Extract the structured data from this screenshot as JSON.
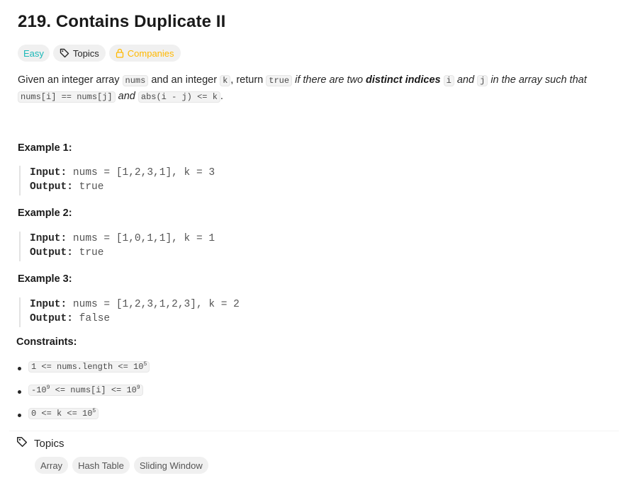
{
  "problem": {
    "title": "219. Contains Duplicate II",
    "difficulty": "Easy",
    "topics_label": "Topics",
    "companies_label": "Companies"
  },
  "description": {
    "t1": "Given an integer array ",
    "c1": "nums",
    "t2": " and an integer ",
    "c2": "k",
    "t3": ", return ",
    "c3": "true",
    "t4": " if there are two ",
    "b1": "distinct indices",
    "t5": " ",
    "c4": "i",
    "t6": " and ",
    "c5": "j",
    "t7": " in the array such that ",
    "c6": "nums[i] == nums[j]",
    "t8": " and ",
    "c7": "abs(i - j) <= k",
    "t9": "."
  },
  "examples": [
    {
      "title": "Example 1:",
      "input_label": "Input:",
      "input": "nums = [1,2,3,1], k = 3",
      "output_label": "Output:",
      "output": "true"
    },
    {
      "title": "Example 2:",
      "input_label": "Input:",
      "input": "nums = [1,0,1,1], k = 1",
      "output_label": "Output:",
      "output": "true"
    },
    {
      "title": "Example 3:",
      "input_label": "Input:",
      "input": "nums = [1,2,3,1,2,3], k = 2",
      "output_label": "Output:",
      "output": "false"
    }
  ],
  "constraints": {
    "title": "Constraints:",
    "items": [
      {
        "pre": "1 <= nums.length <= 10",
        "exp": "5",
        "post": ""
      },
      {
        "pre": "-10",
        "exp": "9",
        "mid": " <= nums[i] <= 10",
        "exp2": "9"
      },
      {
        "pre": "0 <= k <= 10",
        "exp": "5",
        "post": ""
      }
    ]
  },
  "topics_section": {
    "label": "Topics",
    "chips": [
      "Array",
      "Hash Table",
      "Sliding Window"
    ]
  },
  "colors": {
    "easy": "#1cb8b8",
    "companies": "#ffb800",
    "chip_bg": "#f0f0f0"
  }
}
